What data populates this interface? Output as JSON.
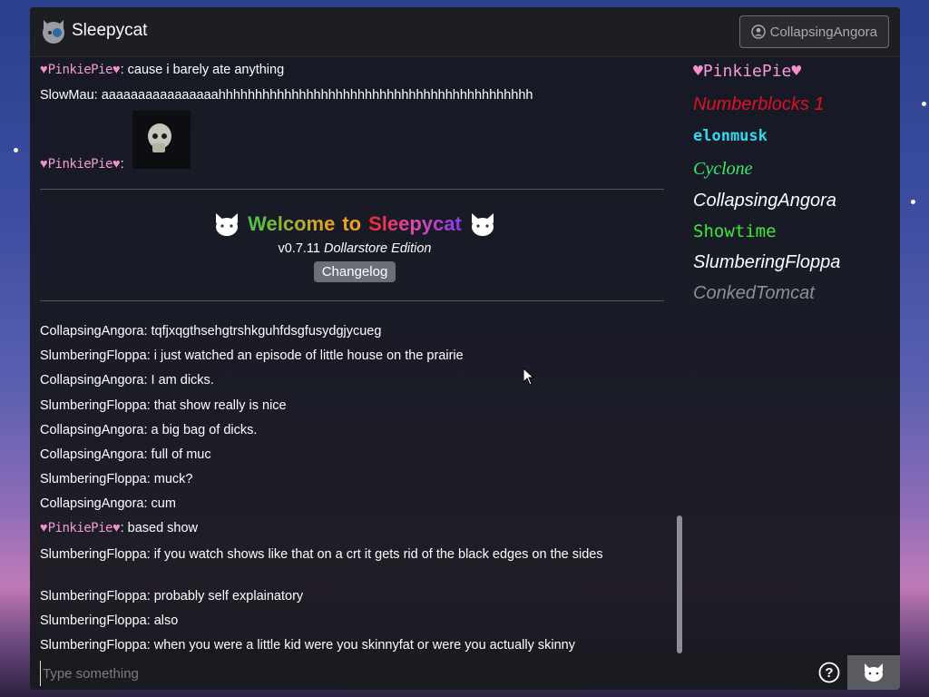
{
  "header": {
    "app_name": "Sleepycat",
    "current_user": "CollapsingAngora"
  },
  "messages_top": [
    {
      "user": "PinkiePie",
      "text": ": cause i barely ate anything"
    },
    {
      "user": "SlowMau",
      "text": ": aaaaaaaaaaaaaaaahhhhhhhhhhhhhhhhhhhhhhhhhhhhhhhhhhhhhhhhhhh"
    },
    {
      "user": "PinkiePie",
      "text": ":"
    }
  ],
  "welcome": {
    "title_words": [
      "Welcome",
      "to",
      "Sleepycat"
    ],
    "version": "v0.7.11",
    "edition": "Dollarstore Edition",
    "changelog_label": "Changelog"
  },
  "messages": [
    {
      "user": "CollapsingAngora",
      "text": ": tqfjxqgthsehgtrshkguhfdsgfusydgjycueg"
    },
    {
      "user": "SlumberingFloppa",
      "text": ": i just watched an episode of little house on the prairie"
    },
    {
      "user": "CollapsingAngora",
      "text": ": I am dicks."
    },
    {
      "user": "SlumberingFloppa",
      "text": ": that show really is nice"
    },
    {
      "user": "CollapsingAngora",
      "text": ": a big bag of dicks."
    },
    {
      "user": "CollapsingAngora",
      "text": ": full of muc"
    },
    {
      "user": "SlumberingFloppa",
      "text": ": muck?"
    },
    {
      "user": "CollapsingAngora",
      "text": ": cum"
    },
    {
      "user": "PinkiePie",
      "text": ": based show"
    },
    {
      "user": "SlumberingFloppa",
      "text": ": if you watch shows like that on a crt it gets rid of the black edges on the sides"
    },
    {
      "user": "SlumberingFloppa",
      "text": ": probably self explainatory"
    },
    {
      "user": "SlumberingFloppa",
      "text": ": also"
    },
    {
      "user": "SlumberingFloppa",
      "text": ": when you were a little kid were you skinnyfat or were you actually skinny"
    }
  ],
  "online_users": [
    {
      "name": "PinkiePie",
      "color": "#f39bd5"
    },
    {
      "name": "Numberblocks 1",
      "color": "#e0102a"
    },
    {
      "name": "elonmusk",
      "color": "#33d7ee"
    },
    {
      "name": "Cyclone",
      "color": "#3de872"
    },
    {
      "name": "CollapsingAngora",
      "color": "#ffffff"
    },
    {
      "name": "Showtime",
      "color": "#3de83d"
    },
    {
      "name": "SlumberingFloppa",
      "color": "#ffffff"
    },
    {
      "name": "ConkedTomcat",
      "color": "#8e8f96"
    }
  ],
  "input": {
    "placeholder": "Type something"
  },
  "icons": {
    "logo": "cat-logo-icon",
    "user": "user-circle-icon",
    "help": "question-circle-icon",
    "send": "cat-send-icon"
  }
}
